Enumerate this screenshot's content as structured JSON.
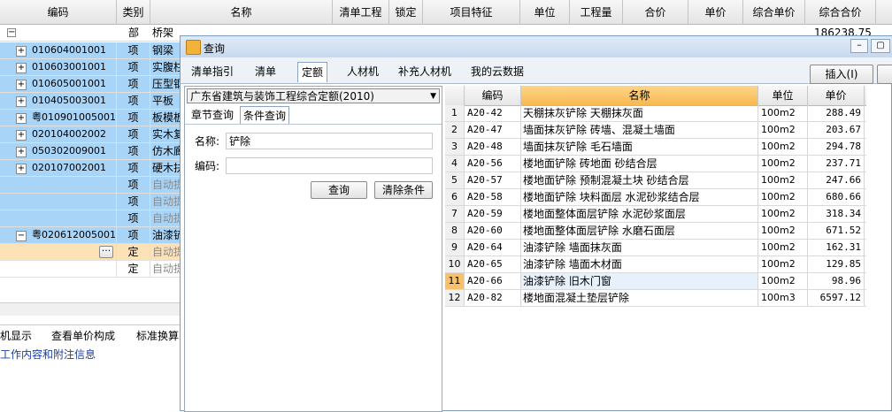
{
  "grid": {
    "columns": [
      "编码",
      "类别",
      "名称",
      "清单工程",
      "锁定",
      "项目特征",
      "单位",
      "工程量",
      "合价",
      "单价",
      "综合单价",
      "综合合价"
    ],
    "first_row": {
      "type": "部",
      "name": "桥架",
      "total": "186238.75"
    },
    "rows": [
      {
        "code": "010604001001",
        "type": "项",
        "name": "钢梁"
      },
      {
        "code": "010603001001",
        "type": "项",
        "name": "实腹柱"
      },
      {
        "code": "010605001001",
        "type": "项",
        "name": "压型钢"
      },
      {
        "code": "010405003001",
        "type": "项",
        "name": "平板"
      },
      {
        "code": "粤010901005001",
        "type": "项",
        "name": "板模板"
      },
      {
        "code": "020104002002",
        "type": "项",
        "name": "实木复"
      },
      {
        "code": "050302009001",
        "type": "项",
        "name": "仿木廊"
      },
      {
        "code": "020107002001",
        "type": "项",
        "name": "硬木扶"
      },
      {
        "code": "",
        "type": "项",
        "name": "自动提"
      },
      {
        "code": "",
        "type": "项",
        "name": "自动提"
      },
      {
        "code": "",
        "type": "项",
        "name": "自动提"
      },
      {
        "code": "粤020612005001",
        "type": "项",
        "name": "油漆铲"
      },
      {
        "code": "",
        "type": "定",
        "name": "自动提"
      },
      {
        "code": "",
        "type": "定",
        "name": "自动提"
      }
    ],
    "bottom_tabs": [
      "机显示",
      "查看单价构成",
      "标准换算"
    ],
    "bottom_link": "工作内容和附注信息"
  },
  "dialog": {
    "title": "查询",
    "tabs": [
      "清单指引",
      "清单",
      "定额",
      "人材机",
      "补充人材机",
      "我的云数据"
    ],
    "active_tab": "定额",
    "insert_button": "插入(I)",
    "quota_library": "广东省建筑与装饰工程综合定额(2010)",
    "subtabs": [
      "章节查询",
      "条件查询"
    ],
    "name_label": "名称:",
    "name_value": "铲除",
    "code_label": "编码:",
    "code_value": "",
    "query_button": "查询",
    "clear_button": "清除条件",
    "results": {
      "headers": [
        "编码",
        "名称",
        "单位",
        "单价"
      ],
      "rows": [
        {
          "n": "1",
          "code": "A20-42",
          "name": "天棚抹灰铲除 天棚抹灰面",
          "unit": "100m2",
          "price": "288.49"
        },
        {
          "n": "2",
          "code": "A20-47",
          "name": "墙面抹灰铲除 砖墙、混凝土墙面",
          "unit": "100m2",
          "price": "203.67"
        },
        {
          "n": "3",
          "code": "A20-48",
          "name": "墙面抹灰铲除 毛石墙面",
          "unit": "100m2",
          "price": "294.78"
        },
        {
          "n": "4",
          "code": "A20-56",
          "name": "楼地面铲除 砖地面 砂结合层",
          "unit": "100m2",
          "price": "237.71"
        },
        {
          "n": "5",
          "code": "A20-57",
          "name": "楼地面铲除 预制混凝土块 砂结合层",
          "unit": "100m2",
          "price": "247.66"
        },
        {
          "n": "6",
          "code": "A20-58",
          "name": "楼地面铲除 块料面层 水泥砂浆结合层",
          "unit": "100m2",
          "price": "680.66"
        },
        {
          "n": "7",
          "code": "A20-59",
          "name": "楼地面整体面层铲除 水泥砂浆面层",
          "unit": "100m2",
          "price": "318.34"
        },
        {
          "n": "8",
          "code": "A20-60",
          "name": "楼地面整体面层铲除 水磨石面层",
          "unit": "100m2",
          "price": "671.52"
        },
        {
          "n": "9",
          "code": "A20-64",
          "name": "油漆铲除 墙面抹灰面",
          "unit": "100m2",
          "price": "162.31"
        },
        {
          "n": "10",
          "code": "A20-65",
          "name": "油漆铲除 墙面木材面",
          "unit": "100m2",
          "price": "129.85"
        },
        {
          "n": "11",
          "code": "A20-66",
          "name": "油漆铲除 旧木门窗",
          "unit": "100m2",
          "price": "98.96"
        },
        {
          "n": "12",
          "code": "A20-82",
          "name": "楼地面混凝土垫层铲除",
          "unit": "100m3",
          "price": "6597.12"
        }
      ]
    }
  }
}
